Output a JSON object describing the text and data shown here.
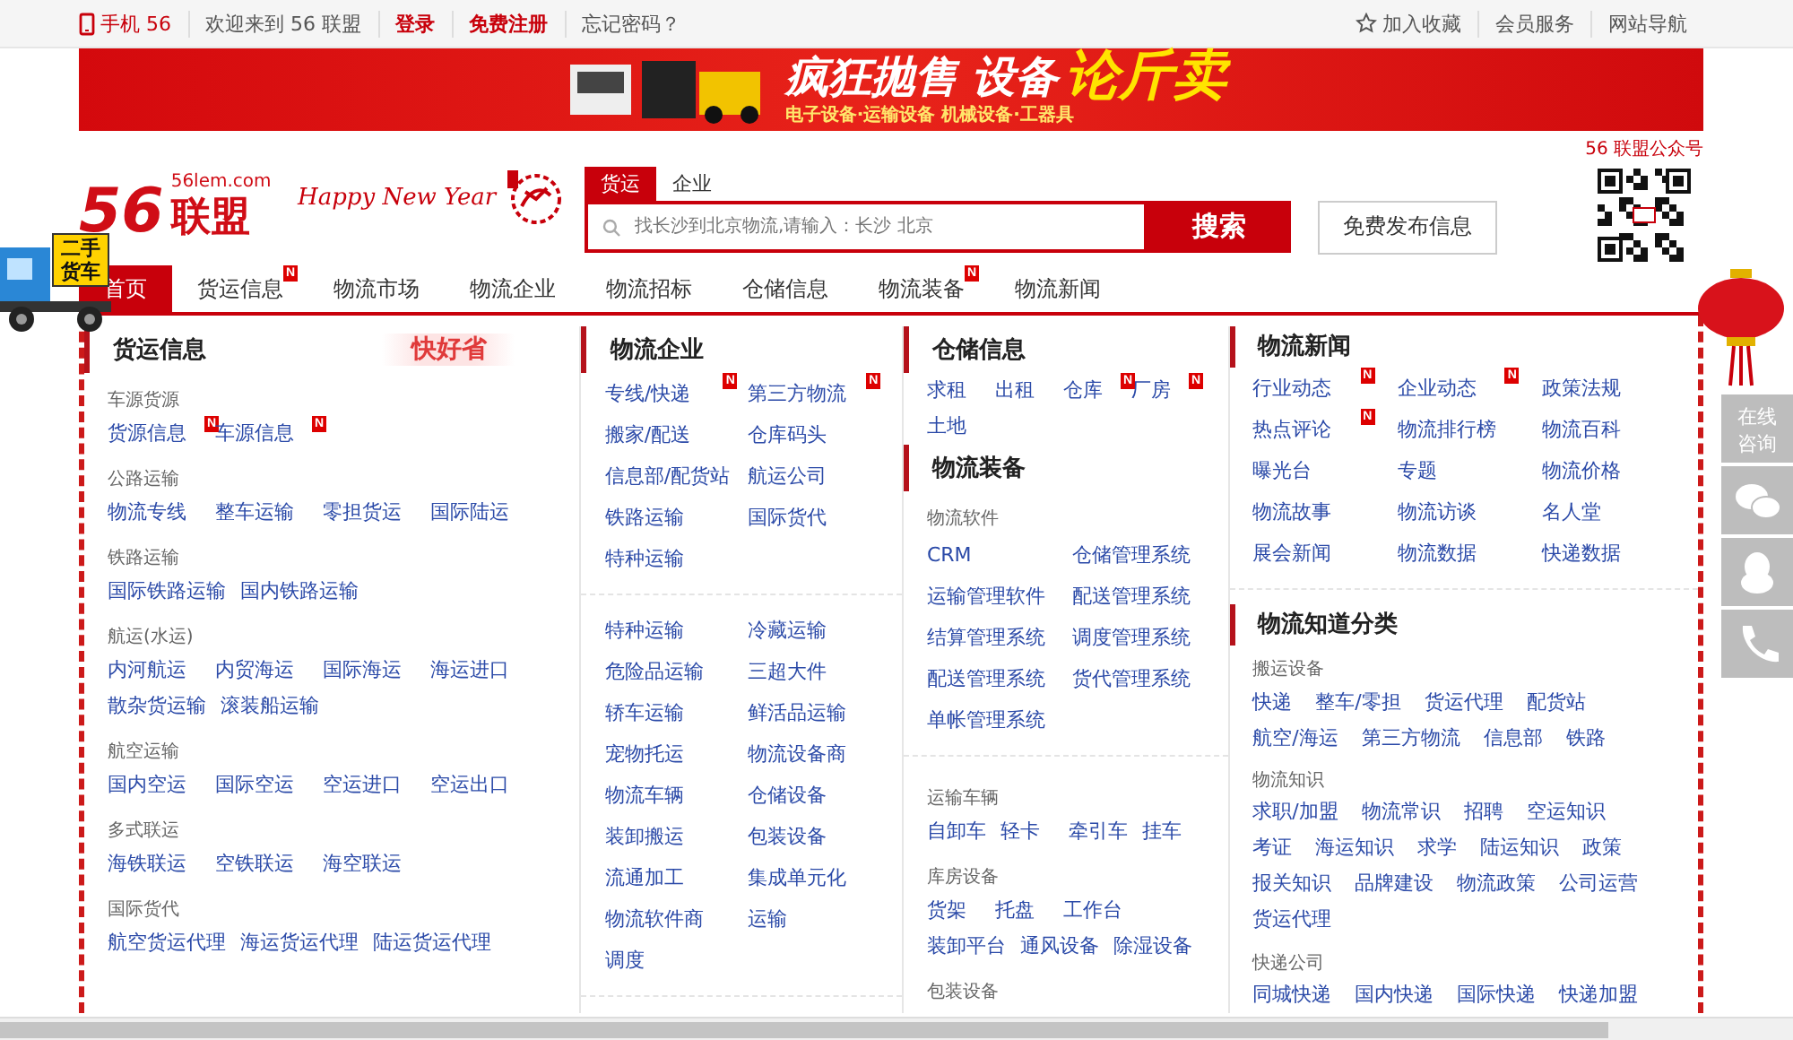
{
  "top_bar": {
    "mobile": "手机 56",
    "welcome": "欢迎来到 56 联盟",
    "login": "登录",
    "register": "免费注册",
    "forgot": "忘记密码？",
    "links": [
      "加入收藏",
      "会员服务",
      "网站导航"
    ]
  },
  "banner": {
    "headline": "疯狂抛售 设备",
    "headline_accent": "论斤卖",
    "subline": "电子设备·运输设备  机械设备·工器具"
  },
  "header": {
    "logo": {
      "number": "56",
      "name": "联盟",
      "domain": "56lem.com"
    },
    "greeting": "Happy New Year",
    "search": {
      "tabs": [
        {
          "label": "货运",
          "selected": true
        },
        {
          "label": "企业",
          "selected": false
        }
      ],
      "placeholder": "找长沙到北京物流,请输入：长沙 北京",
      "button": "搜索"
    },
    "publish_button": "免费发布信息",
    "qr_label": "56 联盟公众号"
  },
  "nav": [
    {
      "label": "首页",
      "selected": true
    },
    {
      "label": "货运信息",
      "selected": false,
      "badge": "N"
    },
    {
      "label": "物流市场",
      "selected": false
    },
    {
      "label": "物流企业",
      "selected": false
    },
    {
      "label": "物流招标",
      "selected": false
    },
    {
      "label": "仓储信息",
      "selected": false
    },
    {
      "label": "物流装备",
      "selected": false,
      "badge": "N"
    },
    {
      "label": "物流新闻",
      "selected": false
    }
  ],
  "truck_sign": "二手货车",
  "side_panel": {
    "consult": "在线咨询"
  },
  "columns": [
    {
      "blocks": [
        {
          "kind": "heading",
          "text": "货运信息",
          "promo": "快好省"
        },
        {
          "kind": "label",
          "text": "车源货源"
        },
        {
          "kind": "links",
          "items": [
            {
              "text": "货源信息",
              "badge": "N"
            },
            {
              "text": "车源信息",
              "badge": "N"
            }
          ]
        },
        {
          "kind": "label",
          "text": "公路运输"
        },
        {
          "kind": "links",
          "items": [
            {
              "text": "物流专线"
            },
            {
              "text": "整车运输"
            },
            {
              "text": "零担货运"
            },
            {
              "text": "国际陆运"
            }
          ]
        },
        {
          "kind": "label",
          "text": "铁路运输"
        },
        {
          "kind": "links",
          "items": [
            {
              "text": "国际铁路运输"
            },
            {
              "text": "国内铁路运输"
            }
          ]
        },
        {
          "kind": "label",
          "text": "航运(水运)"
        },
        {
          "kind": "links",
          "items": [
            {
              "text": "内河航运"
            },
            {
              "text": "内贸海运"
            },
            {
              "text": "国际海运"
            },
            {
              "text": "海运进口"
            },
            {
              "text": "散杂货运输"
            },
            {
              "text": "滚装船运输"
            }
          ]
        },
        {
          "kind": "label",
          "text": "航空运输"
        },
        {
          "kind": "links",
          "items": [
            {
              "text": "国内空运"
            },
            {
              "text": "国际空运"
            },
            {
              "text": "空运进口"
            },
            {
              "text": "空运出口"
            }
          ]
        },
        {
          "kind": "label",
          "text": "多式联运"
        },
        {
          "kind": "links",
          "items": [
            {
              "text": "海铁联运"
            },
            {
              "text": "空铁联运"
            },
            {
              "text": "海空联运"
            }
          ]
        },
        {
          "kind": "label",
          "text": "国际货代"
        },
        {
          "kind": "links",
          "items": [
            {
              "text": "航空货运代理"
            },
            {
              "text": "海运货运代理"
            },
            {
              "text": "陆运货运代理"
            }
          ]
        }
      ]
    },
    {
      "blocks": [
        {
          "kind": "heading",
          "text": "物流企业"
        },
        {
          "kind": "link_grid",
          "items": [
            {
              "text": "专线/快递",
              "badge": "N"
            },
            {
              "text": "第三方物流",
              "badge": "N"
            },
            {
              "text": "搬家/配送"
            },
            {
              "text": "仓库码头"
            },
            {
              "text": "信息部/配货站"
            },
            {
              "text": "航运公司"
            },
            {
              "text": "铁路运输"
            },
            {
              "text": "国际货代"
            },
            {
              "text": "特种运输"
            }
          ]
        },
        {
          "kind": "divider"
        },
        {
          "kind": "link_grid",
          "items": [
            {
              "text": "特种运输"
            },
            {
              "text": "冷藏运输"
            },
            {
              "text": "危险品运输"
            },
            {
              "text": "三超大件"
            },
            {
              "text": "轿车运输"
            },
            {
              "text": "鲜活品运输"
            },
            {
              "text": "宠物托运"
            },
            {
              "text": "物流设备商"
            },
            {
              "text": "物流车辆"
            },
            {
              "text": "仓储设备"
            },
            {
              "text": "装卸搬运"
            },
            {
              "text": "包装设备"
            },
            {
              "text": "流通加工"
            },
            {
              "text": "集成单元化"
            },
            {
              "text": "物流软件商"
            },
            {
              "text": "运输"
            },
            {
              "text": "调度"
            }
          ]
        },
        {
          "kind": "divider"
        }
      ]
    },
    {
      "blocks": [
        {
          "kind": "heading",
          "text": "仓储信息"
        },
        {
          "kind": "links",
          "items": [
            {
              "text": "求租"
            },
            {
              "text": "出租"
            },
            {
              "text": "仓库",
              "badge": "N"
            },
            {
              "text": "厂房",
              "badge": "N"
            },
            {
              "text": "土地"
            }
          ]
        },
        {
          "kind": "heading",
          "text": "物流装备"
        },
        {
          "kind": "label",
          "text": "物流软件"
        },
        {
          "kind": "link_grid",
          "items": [
            {
              "text": "CRM"
            },
            {
              "text": "仓储管理系统"
            },
            {
              "text": "运输管理软件"
            },
            {
              "text": "配送管理系统"
            },
            {
              "text": "结算管理系统"
            },
            {
              "text": "调度管理系统"
            },
            {
              "text": "配送管理系统"
            },
            {
              "text": "货代管理系统"
            },
            {
              "text": "单帐管理系统"
            }
          ]
        },
        {
          "kind": "divider"
        },
        {
          "kind": "label",
          "text": "运输车辆"
        },
        {
          "kind": "links",
          "items": [
            {
              "text": "自卸车"
            },
            {
              "text": "轻卡"
            },
            {
              "text": "牵引车"
            },
            {
              "text": "挂车"
            }
          ]
        },
        {
          "kind": "label",
          "text": "库房设备"
        },
        {
          "kind": "links",
          "items": [
            {
              "text": "货架"
            },
            {
              "text": "托盘"
            },
            {
              "text": "工作台"
            },
            {
              "text": "装卸平台"
            },
            {
              "text": "通风设备"
            },
            {
              "text": "除湿设备"
            }
          ]
        },
        {
          "kind": "label",
          "text": "包装设备"
        }
      ]
    },
    {
      "blocks": [
        {
          "kind": "heading",
          "text": "物流新闻"
        },
        {
          "kind": "link_grid",
          "items": [
            {
              "text": "行业动态",
              "badge": "N"
            },
            {
              "text": "企业动态",
              "badge": "N"
            },
            {
              "text": "政策法规"
            },
            {
              "text": "热点评论",
              "badge": "N"
            },
            {
              "text": "物流排行榜"
            },
            {
              "text": "物流百科"
            },
            {
              "text": "曝光台"
            },
            {
              "text": "专题"
            },
            {
              "text": "物流价格"
            },
            {
              "text": "物流故事"
            },
            {
              "text": "物流访谈"
            },
            {
              "text": "名人堂"
            },
            {
              "text": "展会新闻"
            },
            {
              "text": "物流数据"
            },
            {
              "text": "快递数据"
            }
          ]
        },
        {
          "kind": "divider"
        },
        {
          "kind": "heading",
          "text": "物流知道分类"
        },
        {
          "kind": "label",
          "text": "搬运设备"
        },
        {
          "kind": "links",
          "items": [
            {
              "text": "快递"
            },
            {
              "text": "整车/零担"
            },
            {
              "text": "货运代理"
            },
            {
              "text": "配货站"
            },
            {
              "text": "航空/海运"
            },
            {
              "text": "第三方物流"
            },
            {
              "text": "信息部"
            },
            {
              "text": "铁路"
            }
          ]
        },
        {
          "kind": "label",
          "text": "物流知识"
        },
        {
          "kind": "links",
          "items": [
            {
              "text": "求职/加盟"
            },
            {
              "text": "物流常识"
            },
            {
              "text": "招聘"
            },
            {
              "text": "空运知识"
            },
            {
              "text": "考证"
            },
            {
              "text": "海运知识"
            },
            {
              "text": "求学"
            },
            {
              "text": "陆运知识"
            },
            {
              "text": "政策"
            },
            {
              "text": "报关知识"
            },
            {
              "text": "品牌建设"
            },
            {
              "text": "物流政策"
            },
            {
              "text": "公司运营"
            },
            {
              "text": "货运代理"
            }
          ]
        },
        {
          "kind": "label",
          "text": "快递公司"
        },
        {
          "kind": "links",
          "items": [
            {
              "text": "同城快递"
            },
            {
              "text": "国内快递"
            },
            {
              "text": "国际快递"
            },
            {
              "text": "快递加盟"
            }
          ]
        }
      ]
    }
  ]
}
